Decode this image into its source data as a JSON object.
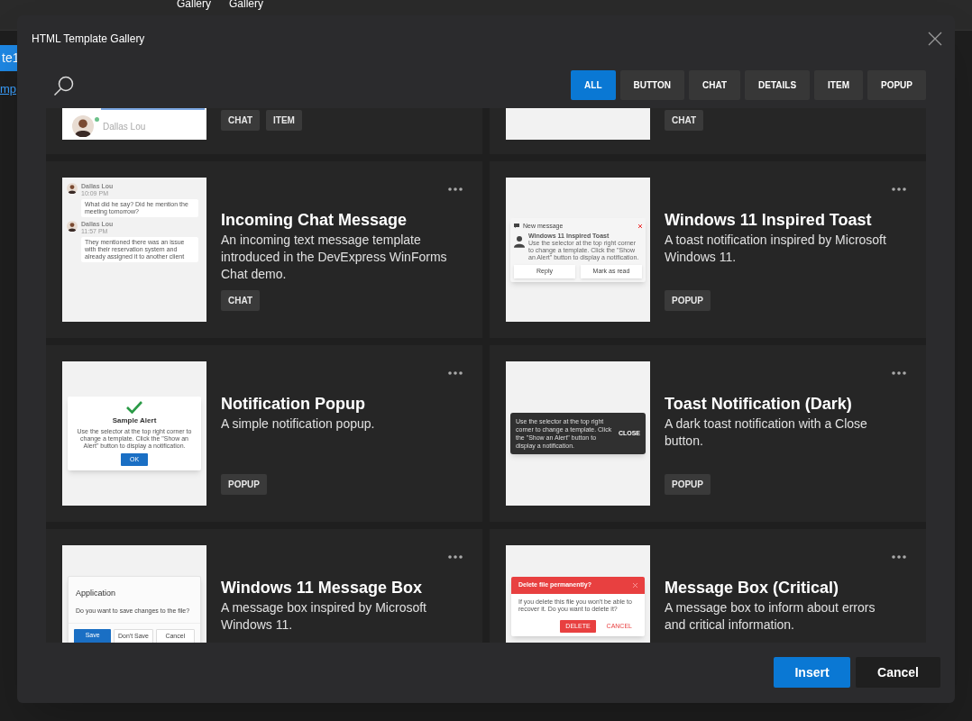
{
  "background": {
    "texts": [
      "Gallery",
      "Gallery"
    ],
    "tab": "te1",
    "link": "mp"
  },
  "window": {
    "title": "HTML Template Gallery"
  },
  "filters": [
    {
      "label": "ALL",
      "selected": true
    },
    {
      "label": "BUTTON",
      "selected": false
    },
    {
      "label": "CHAT",
      "selected": false
    },
    {
      "label": "DETAILS",
      "selected": false
    },
    {
      "label": "ITEM",
      "selected": false
    },
    {
      "label": "POPUP",
      "selected": false
    }
  ],
  "partial_cards": [
    {
      "preview": {
        "kind": "contact",
        "name": "Dallas Lou"
      },
      "tags": [
        "CHAT",
        "ITEM"
      ]
    },
    {
      "preview": {
        "kind": "blank"
      },
      "tags": [
        "CHAT"
      ]
    }
  ],
  "cards": [
    {
      "title": "Incoming Chat Message",
      "description": "An incoming text message template introduced in the DevExpress WinForms Chat demo.",
      "tags": [
        "CHAT"
      ],
      "preview": {
        "kind": "chat",
        "messages": [
          {
            "author": "Dallas Lou",
            "time": "10:09 PM",
            "text": "What did he say? Did he mention the meeting tomorrow?"
          },
          {
            "author": "Dallas Lou",
            "time": "11:57 PM",
            "text": "They mentioned there was an issue with their reservation system and already assigned it to another client"
          }
        ]
      }
    },
    {
      "title": "Windows 11 Inspired Toast",
      "description": "A toast notification inspired by Microsoft Windows 11.",
      "tags": [
        "POPUP"
      ],
      "preview": {
        "kind": "toast",
        "header": "New message",
        "title": "Windows 11 Inspired Toast",
        "text": "Use the selector at the top right corner to change a template. Click the \"Show an Alert\" button to display a notification.",
        "buttons": [
          "Reply",
          "Mark as read"
        ]
      }
    },
    {
      "title": "Notification Popup",
      "description": "A simple notification popup.",
      "tags": [
        "POPUP"
      ],
      "preview": {
        "kind": "alert",
        "title": "Sample Alert",
        "text": "Use the selector at the top right corner to change a template. Click the \"Show an Alert\" button to display a notification.",
        "buttons": [
          "OK"
        ]
      }
    },
    {
      "title": "Toast Notification (Dark)",
      "description": "A dark toast notification with a Close button.",
      "tags": [
        "POPUP"
      ],
      "preview": {
        "kind": "dark_toast",
        "text": "Use the selector at the top right corner to change a template. Click the \"Show an Alert\" button to display a notification.",
        "buttons": [
          "CLOSE"
        ]
      }
    },
    {
      "title": "Windows 11 Message Box",
      "description": "A message box inspired by Microsoft Windows 11.",
      "preview": {
        "kind": "msgbox",
        "title": "Application",
        "text": "Do you want to save changes to the file?",
        "buttons": [
          "Save",
          "Don't Save",
          "Cancel"
        ]
      }
    },
    {
      "title": "Message Box (Critical)",
      "description": "A message box to inform about errors and critical information.",
      "preview": {
        "kind": "critical",
        "title": "Delete file permanently?",
        "text": "If you delete this file you won't be able to recover it. Do you want to delete it?",
        "buttons": [
          "DELETE",
          "CANCEL"
        ]
      }
    }
  ],
  "buttons": [
    {
      "label": "Insert",
      "kind": "primary"
    },
    {
      "label": "Cancel",
      "kind": "secondary"
    }
  ]
}
